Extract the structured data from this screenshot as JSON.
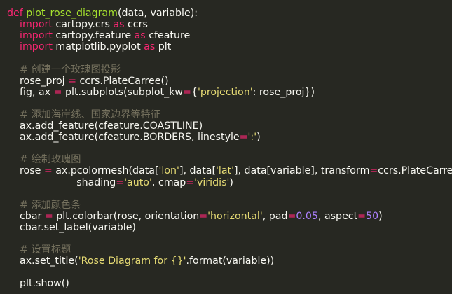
{
  "colors": {
    "background": "#272822",
    "text": "#f8f8f2",
    "keyword": "#f92672",
    "function": "#a6e22e",
    "string": "#e6db74",
    "number": "#ae81ff",
    "comment": "#75715e"
  },
  "code": {
    "lines": [
      {
        "tokens": [
          {
            "t": "kw",
            "v": "def"
          },
          {
            "t": "p",
            "v": " "
          },
          {
            "t": "fn",
            "v": "plot_rose_diagram"
          },
          {
            "t": "p",
            "v": "(data, variable):"
          }
        ]
      },
      {
        "tokens": [
          {
            "t": "p",
            "v": "    "
          },
          {
            "t": "kw",
            "v": "import"
          },
          {
            "t": "p",
            "v": " cartopy.crs "
          },
          {
            "t": "kw",
            "v": "as"
          },
          {
            "t": "p",
            "v": " ccrs"
          }
        ]
      },
      {
        "tokens": [
          {
            "t": "p",
            "v": "    "
          },
          {
            "t": "kw",
            "v": "import"
          },
          {
            "t": "p",
            "v": " cartopy.feature "
          },
          {
            "t": "kw",
            "v": "as"
          },
          {
            "t": "p",
            "v": " cfeature"
          }
        ]
      },
      {
        "tokens": [
          {
            "t": "p",
            "v": "    "
          },
          {
            "t": "kw",
            "v": "import"
          },
          {
            "t": "p",
            "v": " matplotlib.pyplot "
          },
          {
            "t": "kw",
            "v": "as"
          },
          {
            "t": "p",
            "v": " plt"
          }
        ]
      },
      {
        "tokens": []
      },
      {
        "tokens": [
          {
            "t": "p",
            "v": "    "
          },
          {
            "t": "cm",
            "v": "# 创建一个玫瑰图投影"
          }
        ]
      },
      {
        "tokens": [
          {
            "t": "p",
            "v": "    rose_proj "
          },
          {
            "t": "kw",
            "v": "="
          },
          {
            "t": "p",
            "v": " ccrs.PlateCarree()"
          }
        ]
      },
      {
        "tokens": [
          {
            "t": "p",
            "v": "    fig, ax "
          },
          {
            "t": "kw",
            "v": "="
          },
          {
            "t": "p",
            "v": " plt.subplots(subplot_kw"
          },
          {
            "t": "kw",
            "v": "="
          },
          {
            "t": "p",
            "v": "{"
          },
          {
            "t": "str",
            "v": "'projection'"
          },
          {
            "t": "p",
            "v": ": rose_proj})"
          }
        ]
      },
      {
        "tokens": []
      },
      {
        "tokens": [
          {
            "t": "p",
            "v": "    "
          },
          {
            "t": "cm",
            "v": "# 添加海岸线、国家边界等特征"
          }
        ]
      },
      {
        "tokens": [
          {
            "t": "p",
            "v": "    ax.add_feature(cfeature.COASTLINE)"
          }
        ]
      },
      {
        "tokens": [
          {
            "t": "p",
            "v": "    ax.add_feature(cfeature.BORDERS, linestyle"
          },
          {
            "t": "kw",
            "v": "="
          },
          {
            "t": "str",
            "v": "':'"
          },
          {
            "t": "p",
            "v": ")"
          }
        ]
      },
      {
        "tokens": []
      },
      {
        "tokens": [
          {
            "t": "p",
            "v": "    "
          },
          {
            "t": "cm",
            "v": "# 绘制玫瑰图"
          }
        ]
      },
      {
        "tokens": [
          {
            "t": "p",
            "v": "    rose "
          },
          {
            "t": "kw",
            "v": "="
          },
          {
            "t": "p",
            "v": " ax.pcolormesh(data["
          },
          {
            "t": "str",
            "v": "'lon'"
          },
          {
            "t": "p",
            "v": "], data["
          },
          {
            "t": "str",
            "v": "'lat'"
          },
          {
            "t": "p",
            "v": "], data[variable], transform"
          },
          {
            "t": "kw",
            "v": "="
          },
          {
            "t": "p",
            "v": "ccrs.PlateCarree(),"
          }
        ]
      },
      {
        "tokens": [
          {
            "t": "p",
            "v": "                      shading"
          },
          {
            "t": "kw",
            "v": "="
          },
          {
            "t": "str",
            "v": "'auto'"
          },
          {
            "t": "p",
            "v": ", cmap"
          },
          {
            "t": "kw",
            "v": "="
          },
          {
            "t": "str",
            "v": "'viridis'"
          },
          {
            "t": "p",
            "v": ")"
          }
        ]
      },
      {
        "tokens": []
      },
      {
        "tokens": [
          {
            "t": "p",
            "v": "    "
          },
          {
            "t": "cm",
            "v": "# 添加颜色条"
          }
        ]
      },
      {
        "tokens": [
          {
            "t": "p",
            "v": "    cbar "
          },
          {
            "t": "kw",
            "v": "="
          },
          {
            "t": "p",
            "v": " plt.colorbar(rose, orientation"
          },
          {
            "t": "kw",
            "v": "="
          },
          {
            "t": "str",
            "v": "'horizontal'"
          },
          {
            "t": "p",
            "v": ", pad"
          },
          {
            "t": "kw",
            "v": "="
          },
          {
            "t": "num",
            "v": "0.05"
          },
          {
            "t": "p",
            "v": ", aspect"
          },
          {
            "t": "kw",
            "v": "="
          },
          {
            "t": "num",
            "v": "50"
          },
          {
            "t": "p",
            "v": ")"
          }
        ]
      },
      {
        "tokens": [
          {
            "t": "p",
            "v": "    cbar.set_label(variable)"
          }
        ]
      },
      {
        "tokens": []
      },
      {
        "tokens": [
          {
            "t": "p",
            "v": "    "
          },
          {
            "t": "cm",
            "v": "# 设置标题"
          }
        ]
      },
      {
        "tokens": [
          {
            "t": "p",
            "v": "    ax.set_title("
          },
          {
            "t": "str",
            "v": "'Rose Diagram for {}'"
          },
          {
            "t": "p",
            "v": ".format(variable))"
          }
        ]
      },
      {
        "tokens": []
      },
      {
        "tokens": [
          {
            "t": "p",
            "v": "    plt.show()"
          }
        ]
      }
    ]
  }
}
